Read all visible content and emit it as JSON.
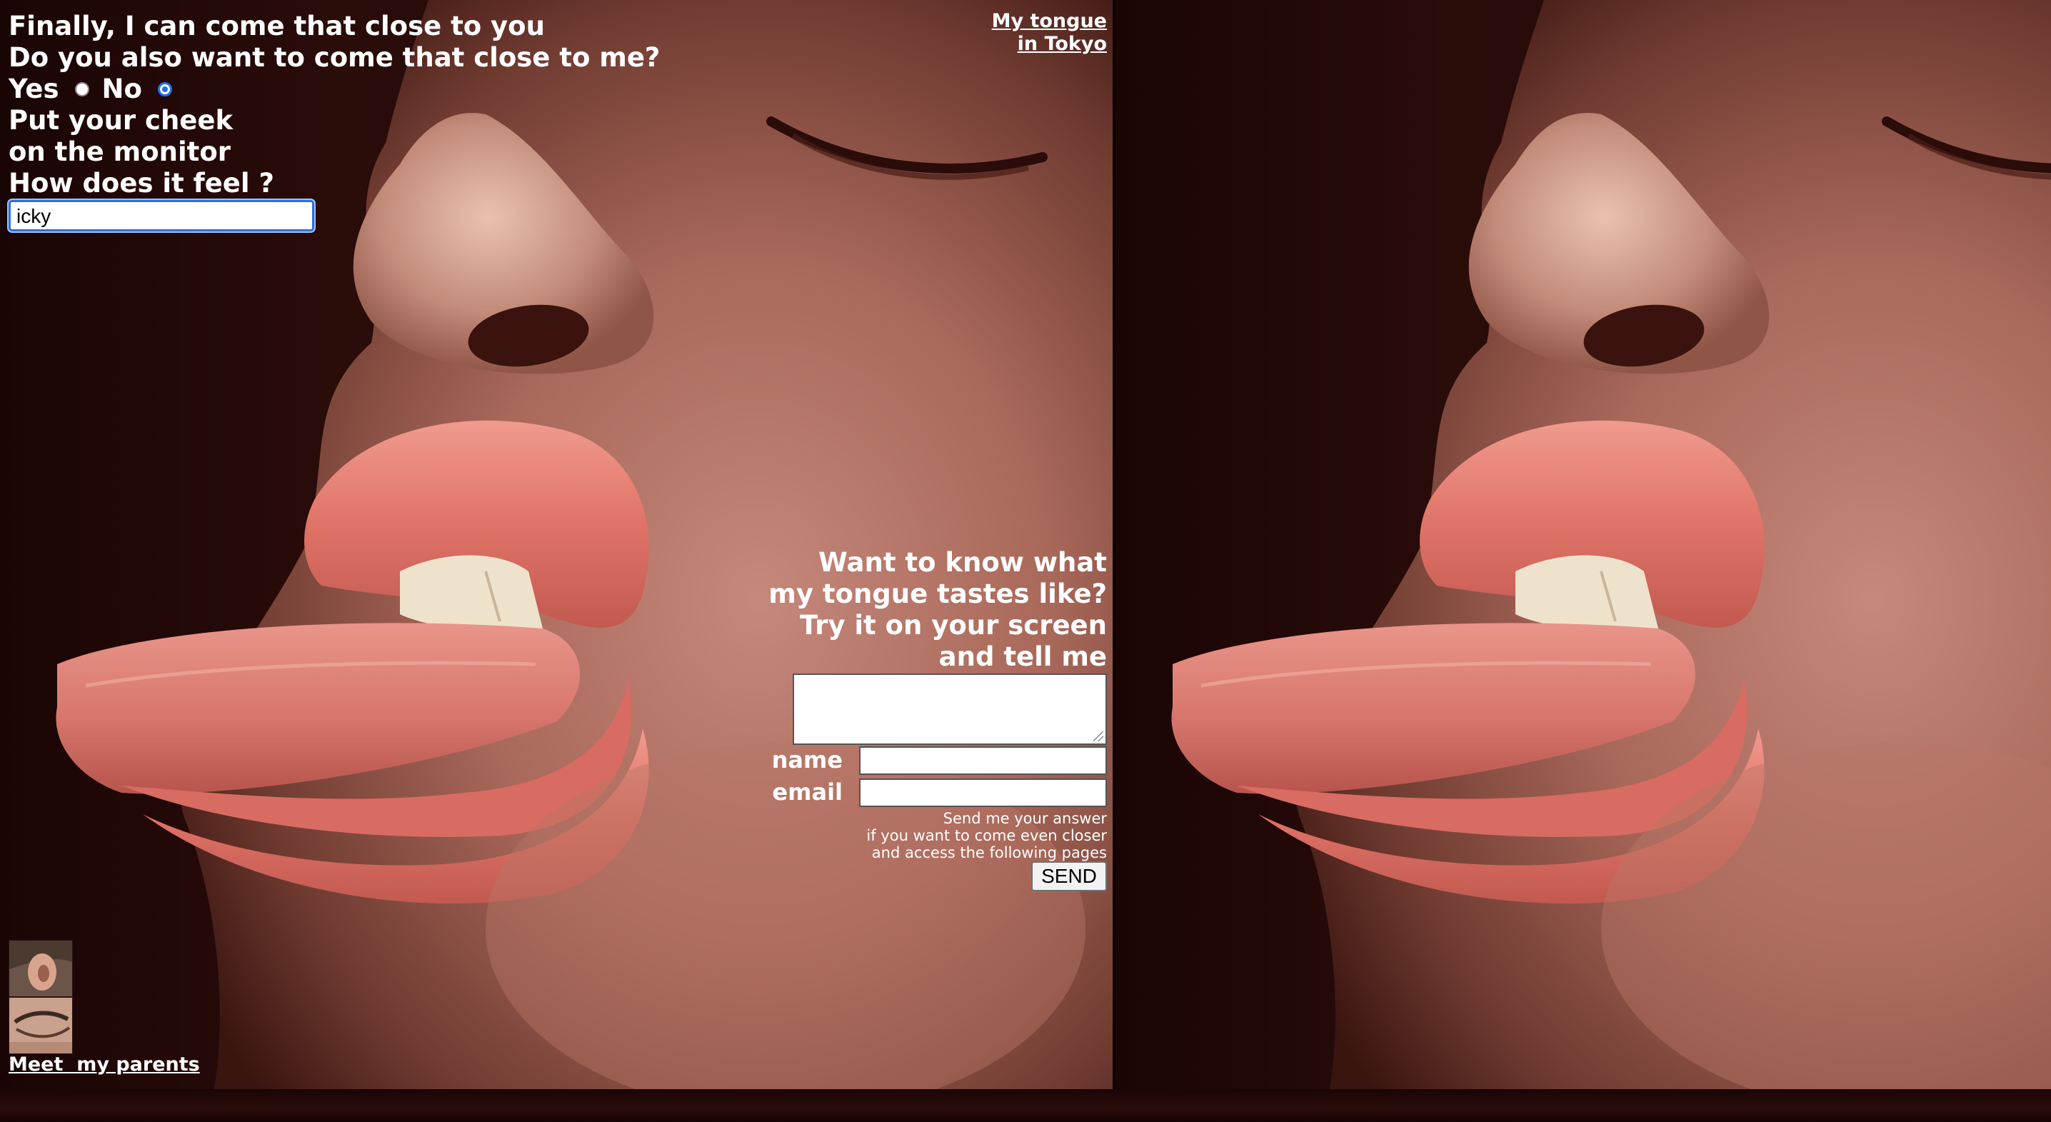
{
  "intro": {
    "line1": "Finally, I can come that close to you",
    "line2": "Do you also want to come that close to me?",
    "yes_label": "Yes",
    "no_label": "No",
    "selected": "No",
    "line3": "Put your cheek",
    "line4": "on the monitor",
    "line5": "How does it feel ?",
    "feel_value": "icky"
  },
  "tokyo_link": {
    "line1": "My tongue",
    "line2": "in Tokyo"
  },
  "taste_prompt": {
    "line1": "Want to know what",
    "line2": "my tongue tastes like?",
    "line3": "Try it on your screen",
    "line4": "and tell me"
  },
  "form": {
    "name_label": "name",
    "email_label": "email",
    "note_line1": "Send me your answer",
    "note_line2": "if you want to come even closer",
    "note_line3": "and access the following pages",
    "send_label": "SEND"
  },
  "parents_link": "Meet  my parents",
  "colors": {
    "background": "#1b0606",
    "skin": "#b57262",
    "lips": "#e0796e",
    "text": "#ffffff",
    "focus_ring": "#2e6fde"
  }
}
